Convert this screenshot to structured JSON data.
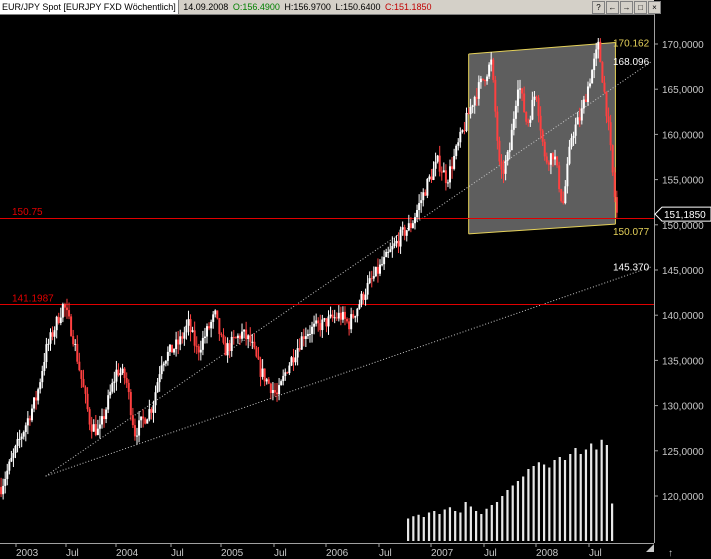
{
  "header": {
    "symbol": "EUR/JPY Spot [EURJPY FXD  Wöchentlich]",
    "date": "14.09.2008",
    "open": "O:156.4900",
    "high": "H:156.9700",
    "low": "L:150.6400",
    "close": "C:151.1850",
    "buttons": [
      "?",
      "←",
      "→",
      "□",
      "×"
    ]
  },
  "colors": {
    "background": "#000000",
    "candle_up": "#ffffff",
    "candle_down": "#ff4040",
    "hline": "#e00000",
    "channel_fill": "#6e6e6e",
    "channel_edge": "#e6d25a",
    "trend_dotted": "#c8c8c8",
    "volume": "#e8e8e8",
    "price_marker": "#ffffff"
  },
  "chart_data": {
    "type": "candlestick",
    "y_axis": {
      "ylim": [
        115000,
        170500
      ],
      "ticks": [
        120000,
        125000,
        130000,
        135000,
        140000,
        145000,
        150000,
        155000,
        160000,
        165000,
        170000
      ],
      "tick_labels": [
        "120,0000",
        "125,0000",
        "130,0000",
        "135,0000",
        "140,0000",
        "145,0000",
        "150,0000",
        "155,0000",
        "160,0000",
        "165,0000",
        "170,0000"
      ],
      "position": "right"
    },
    "x_axis": {
      "labels": [
        "2003",
        "Jul",
        "2004",
        "Jul",
        "2005",
        "Jul",
        "2006",
        "Jul",
        "2007",
        "Jul",
        "2008",
        "Jul"
      ]
    },
    "current_price": {
      "value": 151.185,
      "label": "151,1850"
    },
    "horizontal_lines": [
      {
        "value": 150.75,
        "label": "150.75"
      },
      {
        "value": 141.1987,
        "label": "141.1987"
      }
    ],
    "trend_lines": [
      {
        "label": "168.096",
        "from": [
          "2003-05",
          122.2
        ],
        "to": [
          "2008-09",
          168.096
        ]
      },
      {
        "label": "145.370",
        "from": [
          "2003-05",
          122.2
        ],
        "to": [
          "2008-09",
          145.37
        ]
      }
    ],
    "channel": {
      "upper": {
        "label": "170.162",
        "from": [
          "2007-05",
          168.9
        ],
        "to": [
          "2008-08",
          170.162
        ]
      },
      "lower": {
        "label": "150.077",
        "from": [
          "2007-05",
          149.0
        ],
        "to": [
          "2008-08",
          150.077
        ]
      }
    },
    "anchors": [
      [
        "2002-12",
        121
      ],
      [
        "2003-02",
        126
      ],
      [
        "2003-04",
        131
      ],
      [
        "2003-05",
        136
      ],
      [
        "2003-07",
        141.2
      ],
      [
        "2003-08",
        138
      ],
      [
        "2003-09",
        133
      ],
      [
        "2003-10",
        128
      ],
      [
        "2003-11",
        127
      ],
      [
        "2004-01",
        134
      ],
      [
        "2004-02",
        133
      ],
      [
        "2004-03",
        127
      ],
      [
        "2004-05",
        130
      ],
      [
        "2004-06",
        135
      ],
      [
        "2004-08",
        137
      ],
      [
        "2004-09",
        139
      ],
      [
        "2004-10",
        136
      ],
      [
        "2004-12",
        140
      ],
      [
        "2005-01",
        136
      ],
      [
        "2005-03",
        138
      ],
      [
        "2005-04",
        137
      ],
      [
        "2005-05",
        134
      ],
      [
        "2005-07",
        131
      ],
      [
        "2005-08",
        134
      ],
      [
        "2005-10",
        138
      ],
      [
        "2005-12",
        139
      ],
      [
        "2006-02",
        140
      ],
      [
        "2006-03",
        139
      ],
      [
        "2006-05",
        143
      ],
      [
        "2006-07",
        146
      ],
      [
        "2006-09",
        149
      ],
      [
        "2006-10",
        150
      ],
      [
        "2006-12",
        155
      ],
      [
        "2007-01",
        157
      ],
      [
        "2007-02",
        155
      ],
      [
        "2007-03",
        158
      ],
      [
        "2007-05",
        164
      ],
      [
        "2007-07",
        168
      ],
      [
        "2007-08",
        155
      ],
      [
        "2007-09",
        158
      ],
      [
        "2007-10",
        166
      ],
      [
        "2007-11",
        161
      ],
      [
        "2007-12",
        165
      ],
      [
        "2008-01",
        157
      ],
      [
        "2008-02",
        158
      ],
      [
        "2008-03",
        152
      ],
      [
        "2008-04",
        160
      ],
      [
        "2008-05",
        162
      ],
      [
        "2008-06",
        166
      ],
      [
        "2008-07",
        169.8
      ],
      [
        "2008-08",
        162
      ],
      [
        "2008-09",
        151.185
      ]
    ],
    "volume_bars": [
      3,
      3.3,
      3.5,
      3.2,
      3.8,
      4,
      3.6,
      4.2,
      4.5,
      4,
      3.8,
      5.2,
      4.6,
      4,
      3.6,
      4.3,
      4.8,
      5.2,
      6,
      6.8,
      7.4,
      8,
      8.6,
      9.6,
      10,
      10.5,
      10.2,
      9.8,
      10.8,
      11.2,
      10.8,
      11.6,
      12.4,
      11.6,
      12.2,
      13,
      12.2,
      13.5,
      12.8,
      5
    ]
  }
}
